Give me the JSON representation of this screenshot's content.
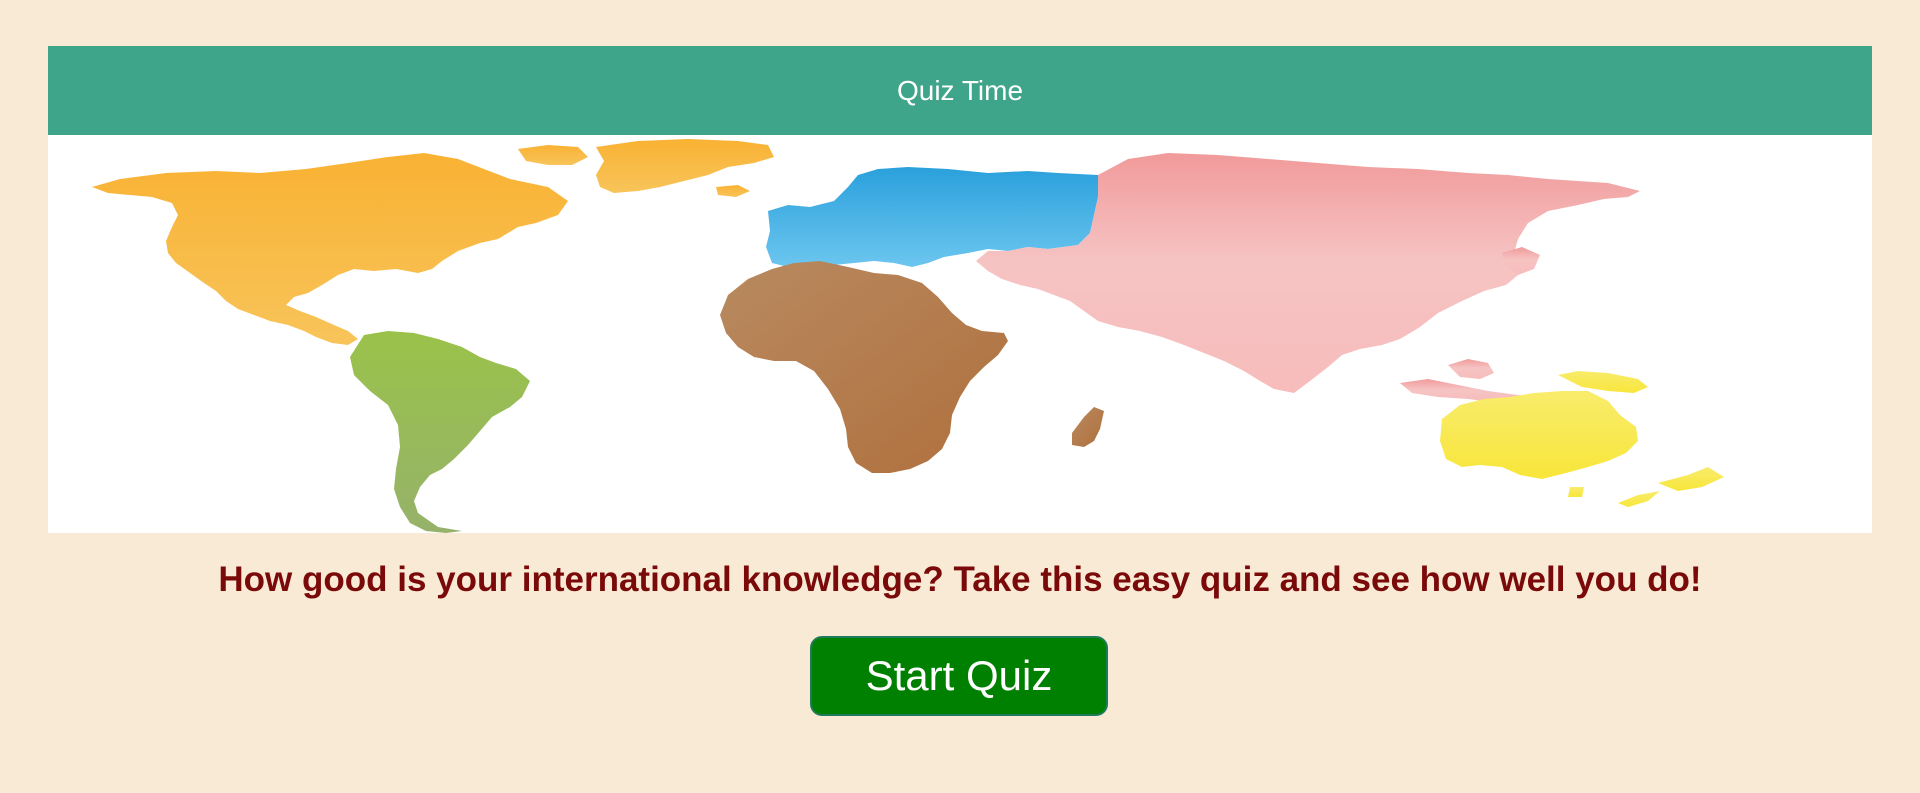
{
  "header": {
    "title": "Quiz Time"
  },
  "map": {
    "image_name": "world-map-continents",
    "continents": [
      {
        "name": "north-america",
        "color": "#f9b233"
      },
      {
        "name": "south-america",
        "color": "#97be4d"
      },
      {
        "name": "europe",
        "color": "#3aaae2"
      },
      {
        "name": "africa",
        "color": "#b57b4a"
      },
      {
        "name": "asia",
        "color": "#f4b3b3"
      },
      {
        "name": "australia",
        "color": "#f7e84a"
      }
    ]
  },
  "main": {
    "intro_text": "How good is your international knowledge? Take this easy quiz and see how well you do!",
    "start_button_label": "Start Quiz"
  },
  "colors": {
    "page_background": "#f9ead6",
    "header_background": "#3fa58a",
    "intro_text": "#7a0a0a",
    "button_background": "#008000"
  }
}
